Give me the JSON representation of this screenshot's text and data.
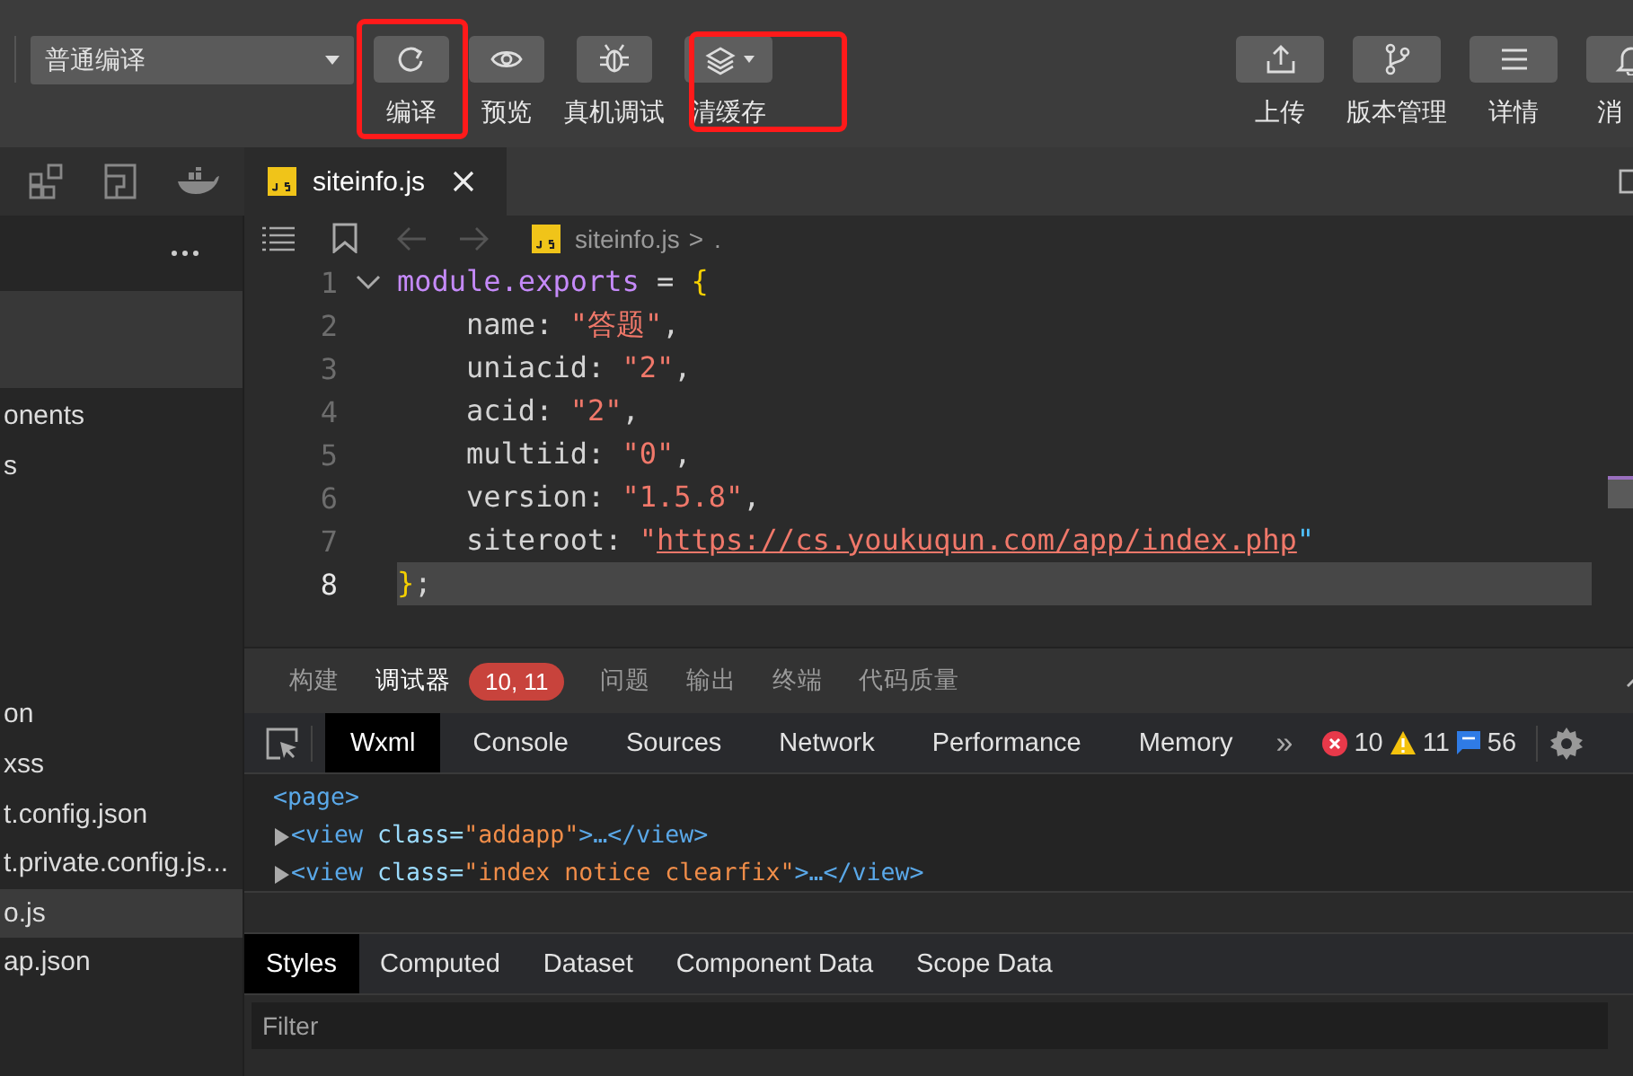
{
  "toolbar": {
    "compile_mode": "普通编译",
    "left_buttons": [
      {
        "kind": "plain",
        "label": "编译"
      },
      {
        "kind": "plain",
        "label": "预览"
      },
      {
        "kind": "plain",
        "label": "真机调试"
      },
      {
        "kind": "dropdown",
        "label": "清缓存"
      }
    ],
    "right_buttons": [
      {
        "label": "上传"
      },
      {
        "label": "版本管理"
      },
      {
        "label": "详情"
      },
      {
        "label": "消"
      }
    ]
  },
  "editor_tabs": [
    {
      "label": "siteinfo.js",
      "selected": true
    }
  ],
  "sidebar": {
    "items": [
      {
        "label": "onents",
        "selected": false
      },
      {
        "label": "s",
        "selected": false
      },
      {
        "label": "on",
        "selected": false
      },
      {
        "label": "xss",
        "selected": false
      },
      {
        "label": "t.config.json",
        "selected": false
      },
      {
        "label": "t.private.config.js...",
        "selected": false
      },
      {
        "label": "o.js",
        "selected": true
      },
      {
        "label": "ap.json",
        "selected": false
      }
    ]
  },
  "breadcrumb": {
    "file": "siteinfo.js",
    "separator": ">",
    "tail": "."
  },
  "code": {
    "lines": [
      {
        "number": "1",
        "selected": false,
        "tokens": [
          {
            "kind": "keyword",
            "text": "module.exports"
          },
          {
            "kind": "plain",
            "text": " = "
          },
          {
            "kind": "brace",
            "text": "{"
          }
        ]
      },
      {
        "number": "2",
        "selected": false,
        "tokens": [
          {
            "kind": "plain",
            "text": "    name: "
          },
          {
            "kind": "string",
            "text": "\"答题\""
          },
          {
            "kind": "plain",
            "text": ","
          }
        ]
      },
      {
        "number": "3",
        "selected": false,
        "tokens": [
          {
            "kind": "plain",
            "text": "    uniacid: "
          },
          {
            "kind": "string",
            "text": "\"2\""
          },
          {
            "kind": "plain",
            "text": ","
          }
        ]
      },
      {
        "number": "4",
        "selected": false,
        "tokens": [
          {
            "kind": "plain",
            "text": "    acid: "
          },
          {
            "kind": "string",
            "text": "\"2\""
          },
          {
            "kind": "plain",
            "text": ","
          }
        ]
      },
      {
        "number": "5",
        "selected": false,
        "tokens": [
          {
            "kind": "plain",
            "text": "    multiid: "
          },
          {
            "kind": "string",
            "text": "\"0\""
          },
          {
            "kind": "plain",
            "text": ","
          }
        ]
      },
      {
        "number": "6",
        "selected": false,
        "tokens": [
          {
            "kind": "plain",
            "text": "    version: "
          },
          {
            "kind": "string",
            "text": "\"1.5.8\""
          },
          {
            "kind": "plain",
            "text": ","
          }
        ]
      },
      {
        "number": "7",
        "selected": false,
        "tokens": [
          {
            "kind": "plain",
            "text": "    siteroot: "
          },
          {
            "kind": "string",
            "text": "\""
          },
          {
            "kind": "link",
            "text": "https://cs.youkuqun.com/app/index.php"
          },
          {
            "kind": "quote",
            "text": "\""
          }
        ]
      },
      {
        "number": "8",
        "selected": true,
        "tokens": [
          {
            "kind": "brace",
            "text": "}"
          },
          {
            "kind": "plain",
            "text": ";"
          }
        ]
      }
    ]
  },
  "panel_tabs": [
    {
      "label": "构建",
      "selected": false
    },
    {
      "label": "调试器",
      "selected": true,
      "badge": "10, 11"
    },
    {
      "label": "问题",
      "selected": false
    },
    {
      "label": "输出",
      "selected": false
    },
    {
      "label": "终端",
      "selected": false
    },
    {
      "label": "代码质量",
      "selected": false
    }
  ],
  "devtools_tabs": [
    {
      "label": "Wxml",
      "selected": true
    },
    {
      "label": "Console",
      "selected": false
    },
    {
      "label": "Sources",
      "selected": false
    },
    {
      "label": "Network",
      "selected": false
    },
    {
      "label": "Performance",
      "selected": false
    },
    {
      "label": "Memory",
      "selected": false
    }
  ],
  "devtools_more": "»",
  "counts": {
    "errors": "10",
    "warnings": "11",
    "messages": "56"
  },
  "tree": [
    {
      "kind": "root",
      "tokens": [
        {
          "kind": "tag",
          "text": "<page>"
        }
      ]
    },
    {
      "kind": "node",
      "tokens": [
        {
          "kind": "tag",
          "text": "<view "
        },
        {
          "kind": "attr",
          "text": "class="
        },
        {
          "kind": "value",
          "text": "\"addapp\""
        },
        {
          "kind": "tag",
          "text": ">…</view>"
        }
      ]
    },
    {
      "kind": "node",
      "tokens": [
        {
          "kind": "tag",
          "text": "<view "
        },
        {
          "kind": "attr",
          "text": "class="
        },
        {
          "kind": "value",
          "text": "\"index notice clearfix\""
        },
        {
          "kind": "tag",
          "text": ">…</view>"
        }
      ]
    }
  ],
  "style_tabs": [
    {
      "label": "Styles",
      "selected": true
    },
    {
      "label": "Computed",
      "selected": false
    },
    {
      "label": "Dataset",
      "selected": false
    },
    {
      "label": "Component Data",
      "selected": false
    },
    {
      "label": "Scope Data",
      "selected": false
    }
  ],
  "filter": {
    "placeholder": "Filter"
  }
}
